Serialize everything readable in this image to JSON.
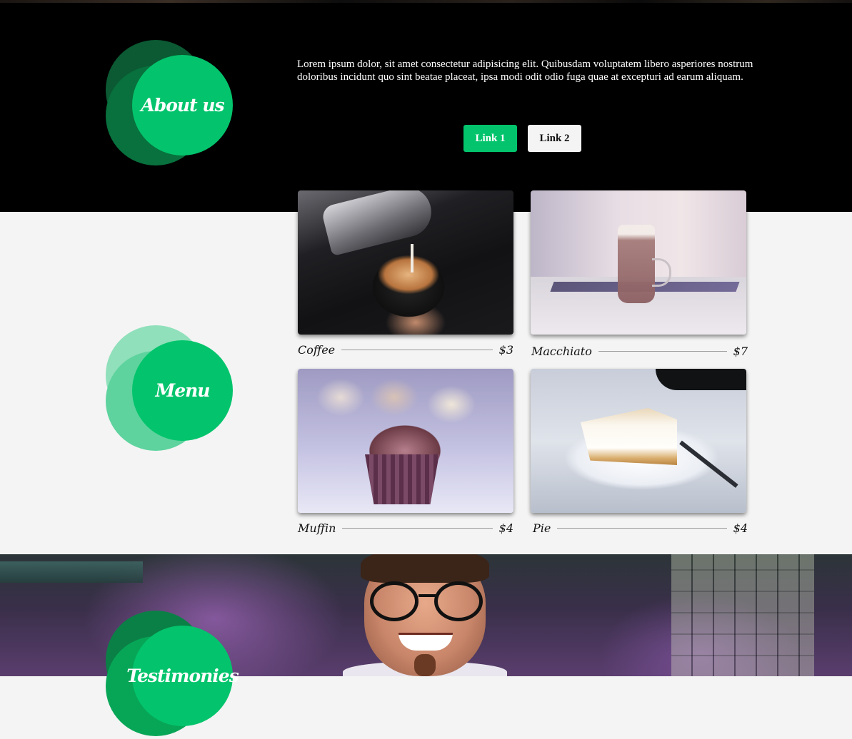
{
  "about": {
    "title": "About us",
    "text": "Lorem ipsum dolor, sit amet consectetur adipisicing elit. Quibusdam voluptatem libero asperiores nostrum doloribus incidunt quo sint beatae placeat, ipsa modi odit odio fuga quae at excepturi ad earum aliquam.",
    "buttons": [
      {
        "label": "Link 1",
        "color": "#03c46c"
      },
      {
        "label": "Link 2",
        "color": "#f4f4f4"
      }
    ]
  },
  "menu": {
    "title": "Menu",
    "items": [
      {
        "name": "Coffee",
        "price": "$3",
        "image": "latte-art-photo"
      },
      {
        "name": "Macchiato",
        "price": "$7",
        "image": "macchiato-glass-photo"
      },
      {
        "name": "Muffin",
        "price": "$4",
        "image": "cupcake-photo"
      },
      {
        "name": "Pie",
        "price": "$4",
        "image": "pie-slice-photo"
      }
    ]
  },
  "testimonials": {
    "title": "Testimonies"
  },
  "colors": {
    "accent": "#03c46c",
    "about_bg": "#000000",
    "menu_bg": "#f4f4f4"
  }
}
